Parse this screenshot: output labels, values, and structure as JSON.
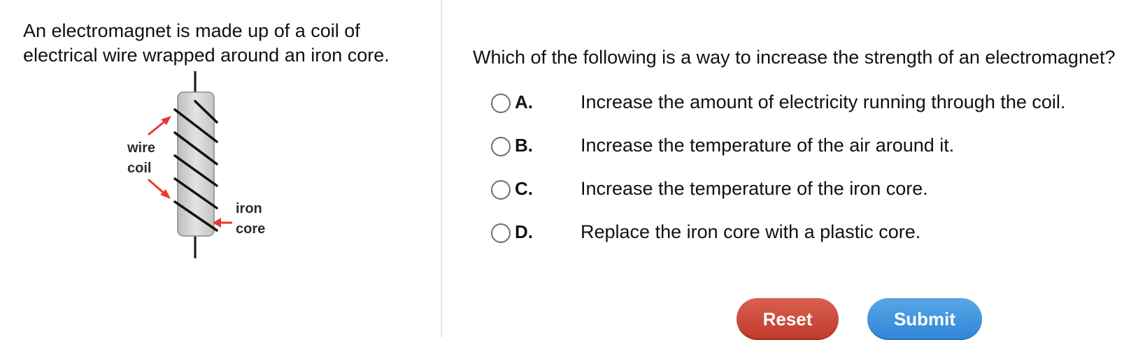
{
  "stimulus": {
    "text": "An electromagnet is made up of a coil of electrical wire wrapped around an iron core.",
    "diagram": {
      "label_wire": "wire",
      "label_coil": "coil",
      "label_iron": "iron",
      "label_core": "core",
      "arrow_color": "#e53935",
      "core_color": "#d4d4d4"
    }
  },
  "question": {
    "text": "Which of the following is a way to increase the strength of an electromagnet?",
    "choices": [
      {
        "letter": "A.",
        "text": "Increase the amount of electricity running through the coil."
      },
      {
        "letter": "B.",
        "text": "Increase the temperature of the air around it."
      },
      {
        "letter": "C.",
        "text": "Increase the temperature of the iron core."
      },
      {
        "letter": "D.",
        "text": "Replace the iron core with a plastic core."
      }
    ]
  },
  "buttons": {
    "reset_label": "Reset",
    "submit_label": "Submit",
    "reset_color": "#c8473a",
    "submit_color": "#3b8fdc"
  }
}
